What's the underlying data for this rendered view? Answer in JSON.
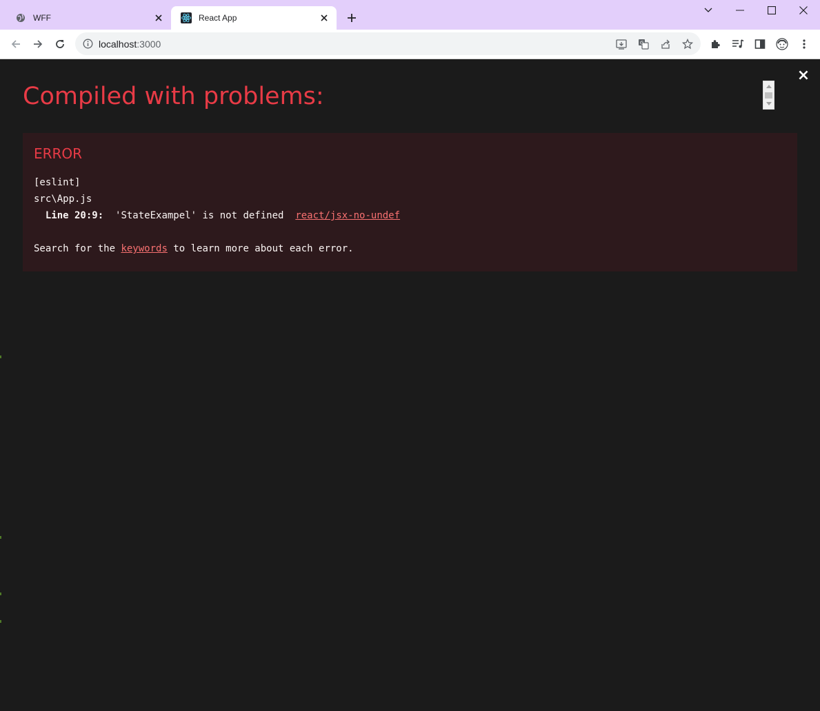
{
  "browser": {
    "tabs": [
      {
        "title": "WFF",
        "active": false,
        "icon": "globe-icon"
      },
      {
        "title": "React App",
        "active": true,
        "icon": "react-icon"
      }
    ],
    "address": {
      "host": "localhost",
      "port": ":3000"
    },
    "accent_color": "#e3cffb"
  },
  "overlay": {
    "title": "Compiled with problems:",
    "close_symbol": "×",
    "error": {
      "label": "ERROR",
      "source": "[eslint]",
      "file": "src\\App.js",
      "line_prefix": "Line 20:9:",
      "message": "'StateExampel' is not defined",
      "rule": "react/jsx-no-undef",
      "hint_before": "Search for the ",
      "hint_link": "keywords",
      "hint_after": " to learn more about each error."
    },
    "colors": {
      "background": "#1b1b1b",
      "title": "#e83b46",
      "error_box": "#2d191c",
      "link": "#f87171"
    }
  }
}
